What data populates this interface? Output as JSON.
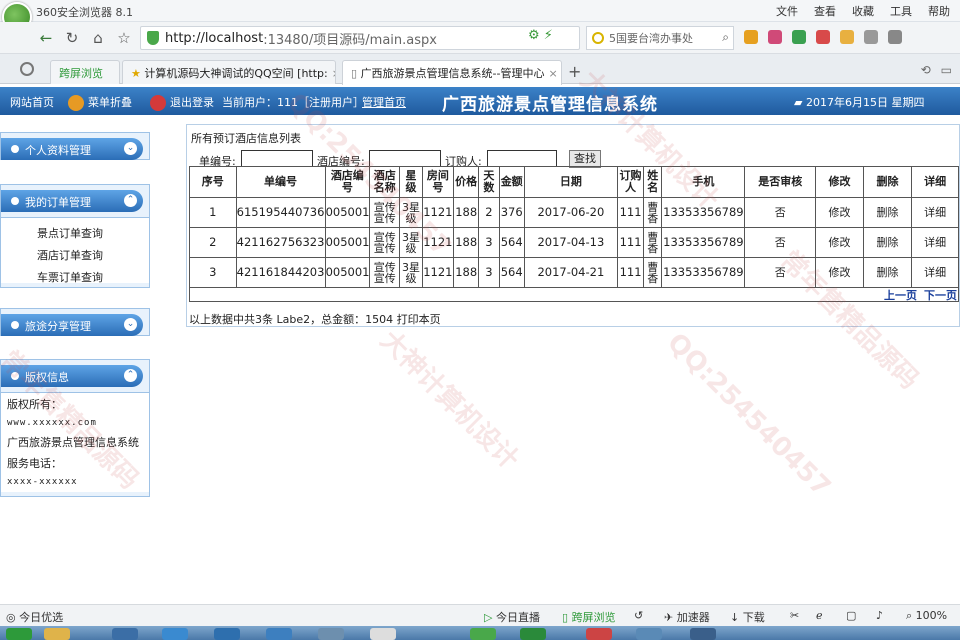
{
  "browser": {
    "title": "360安全浏览器 8.1",
    "menu": [
      "文件",
      "查看",
      "收藏",
      "工具",
      "帮助"
    ],
    "url_host": "http://localhost",
    "url_rest": ":13480/项目源码/main.aspx",
    "search_placeholder": "5国要台湾办事处",
    "tabs": [
      {
        "label": "跨屏浏览"
      },
      {
        "label": "计算机源码大神调试的QQ空间 [http:"
      },
      {
        "label": "广西旅游景点管理信息系统--管理中心"
      }
    ]
  },
  "header": {
    "home": "网站首页",
    "menu_discount": "菜单折叠",
    "logout": "退出登录",
    "current_user": "当前用户：111［注册用户］",
    "manage_home": "管理首页",
    "title": "广西旅游景点管理信息系统",
    "date": "2017年6月15日 星期四"
  },
  "sidebar": {
    "panels": [
      {
        "title": "个人资料管理",
        "items": []
      },
      {
        "title": "我的订单管理",
        "items": [
          "景点订单查询",
          "酒店订单查询",
          "车票订单查询"
        ]
      },
      {
        "title": "旅途分享管理",
        "items": []
      },
      {
        "title": "版权信息",
        "items": []
      }
    ],
    "copyright": {
      "owner_label": "版权所有：",
      "website": "www.xxxxxx.com",
      "system": "广西旅游景点管理信息系统",
      "phone_label": "服务电话：",
      "phone": "xxxx-xxxxxx"
    }
  },
  "main": {
    "title": "所有预订酒店信息列表",
    "search": {
      "order_no_label": "单编号:",
      "hotel_no_label": "酒店编号:",
      "buyer_label": "订购人:",
      "button": "查找"
    },
    "columns": [
      "序号",
      "单编号",
      "酒店编号",
      "酒店名称",
      "星级",
      "房间号",
      "价格",
      "天数",
      "金额",
      "日期",
      "订购人",
      "姓名",
      "手机",
      "是否审核",
      "修改",
      "删除",
      "详细"
    ],
    "rows": [
      [
        "1",
        "615195440736",
        "005001",
        "宣传宣传",
        "3星级",
        "1121",
        "188",
        "2",
        "376",
        "2017-06-20",
        "111",
        "曹香",
        "13353356789",
        "否",
        "修改",
        "删除",
        "详细"
      ],
      [
        "2",
        "421162756323",
        "005001",
        "宣传宣传",
        "3星级",
        "1121",
        "188",
        "3",
        "564",
        "2017-04-13",
        "111",
        "曹香",
        "13353356789",
        "否",
        "修改",
        "删除",
        "详细"
      ],
      [
        "3",
        "421161844203",
        "005001",
        "宣传宣传",
        "3星级",
        "1121",
        "188",
        "3",
        "564",
        "2017-04-21",
        "111",
        "曹香",
        "13353356789",
        "否",
        "修改",
        "删除",
        "详细"
      ]
    ],
    "pager": {
      "prev": "上一页",
      "next": "下一页"
    },
    "summary": "以上数据中共3条 Labe2，总金额：1504 打印本页"
  },
  "watermark": {
    "a": "QQ:254540457",
    "b": "大神计算机设计",
    "c": "常年售精品源码"
  },
  "statusbar": {
    "left": "今日优选",
    "live": "今日直播",
    "cross": "跨屏浏览",
    "accel": "加速器",
    "download": "下载",
    "zoom": "100%"
  }
}
